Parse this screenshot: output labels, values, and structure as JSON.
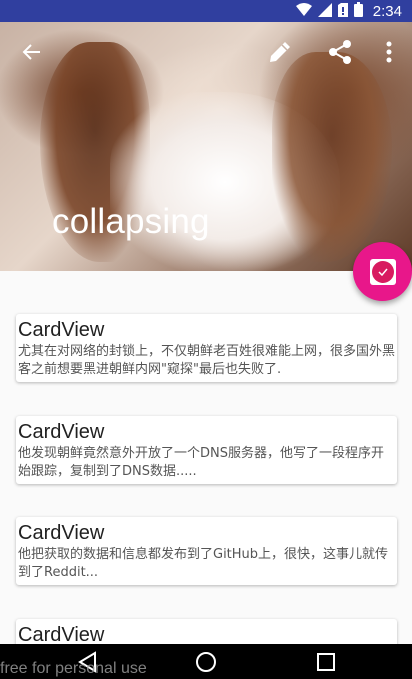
{
  "status_bar": {
    "time": "2:34",
    "icons": [
      "wifi-icon",
      "signal-icon",
      "no-sim-icon",
      "battery-icon"
    ]
  },
  "toolbar": {
    "icons": [
      "back-arrow-icon",
      "edit-pencil-icon",
      "share-icon",
      "more-vert-icon"
    ]
  },
  "header": {
    "title": "collapsing"
  },
  "fab": {
    "icon": "check-badge-icon",
    "color": "#e8178a"
  },
  "cards": [
    {
      "title": "CardView",
      "text": "尤其在对网络的封锁上，不仅朝鲜老百姓很难能上网，很多国外黑客之前想要黑进朝鲜内网\"窥探\"最后也失败了."
    },
    {
      "title": "CardView",
      "text": "他发现朝鲜竟然意外开放了一个DNS服务器，他写了一段程序开始跟踪，复制到了DNS数据....."
    },
    {
      "title": "CardView",
      "text": "他把获取的数据和信息都发布到了GitHub上，很快，这事儿就传到了Reddit..."
    },
    {
      "title": "CardView",
      "text": ""
    }
  ],
  "nav_bar": {
    "icons": [
      "back-triangle-icon",
      "home-circle-icon",
      "recents-square-icon"
    ]
  },
  "watermark": "free for personal use",
  "colors": {
    "status_bar": "#303f9f",
    "accent": "#e8178a",
    "background": "#fafafa"
  }
}
